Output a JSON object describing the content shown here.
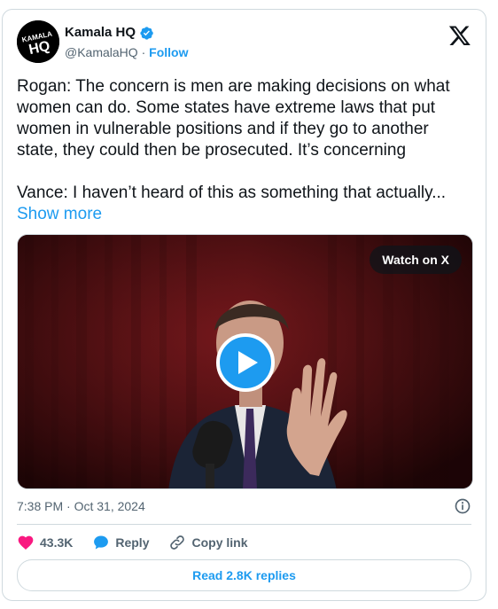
{
  "author": {
    "display_name": "Kamala HQ",
    "handle": "@KamalaHQ",
    "separator": " · ",
    "follow_label": "Follow",
    "avatar_text_line1": "KAMALA",
    "avatar_text_line2": "HQ",
    "verified_color": "#1d9bf0"
  },
  "post": {
    "text": "Rogan: The concern is men are making decisions on what women can do. Some states have extreme laws that put women in vulnerable positions and if they go to another state, they could then be prosecuted. It’s concerning\n\nVance: I haven’t heard of this as something that actually... ",
    "show_more": "Show more"
  },
  "media": {
    "watch_label": "Watch on X"
  },
  "meta": {
    "timestamp": "7:38 PM · Oct 31, 2024"
  },
  "actions": {
    "likes": "43.3K",
    "reply_label": "Reply",
    "copy_label": "Copy link"
  },
  "footer": {
    "read_replies": "Read 2.8K replies"
  },
  "colors": {
    "accent": "#1d9bf0",
    "like": "#f91880",
    "text": "#0f1419",
    "muted": "#536471",
    "border": "#cfd9de"
  }
}
